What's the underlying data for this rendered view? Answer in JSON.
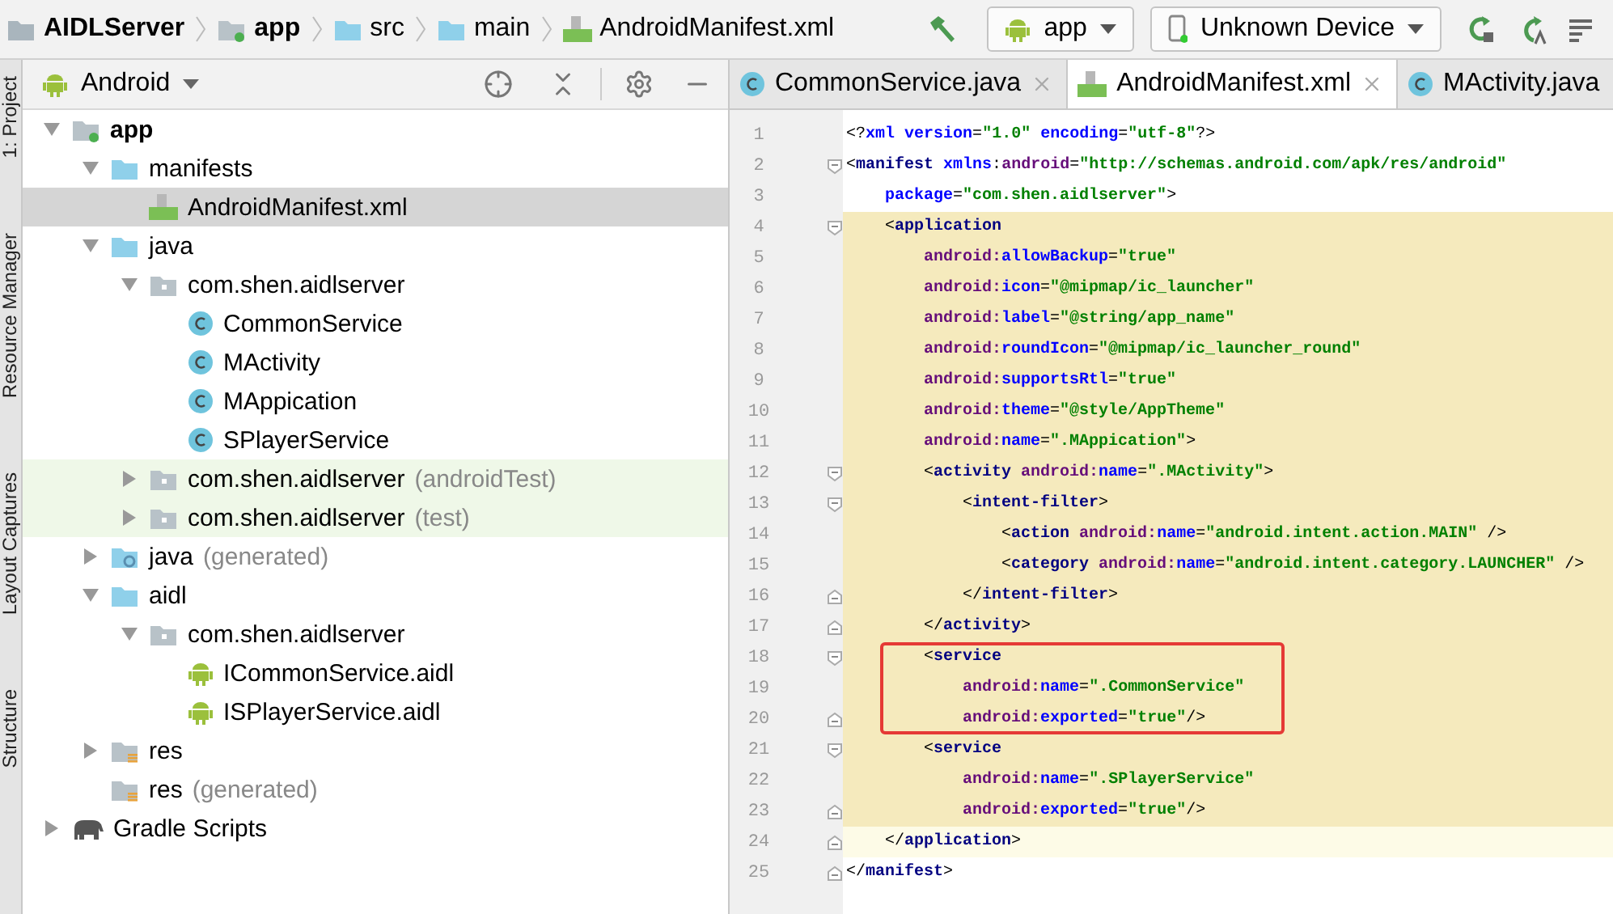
{
  "breadcrumbs": [
    {
      "label": "AIDLServer",
      "kind": "project",
      "bold": true
    },
    {
      "label": "app",
      "kind": "module",
      "bold": true
    },
    {
      "label": "src",
      "kind": "folder",
      "bold": false
    },
    {
      "label": "main",
      "kind": "folder",
      "bold": false
    },
    {
      "label": "AndroidManifest.xml",
      "kind": "manifest",
      "bold": false
    }
  ],
  "toolbar": {
    "run_config": "app",
    "device": "Unknown Device"
  },
  "side_tabs": [
    "1: Project",
    "Resource Manager",
    "Layout Captures",
    "Structure"
  ],
  "project_panel": {
    "view": "Android",
    "tree": [
      {
        "label": "app",
        "kind": "module",
        "bold": true,
        "selected": false,
        "expanded": true,
        "children": [
          {
            "label": "manifests",
            "kind": "folder",
            "selected": false,
            "expanded": true,
            "children": [
              {
                "label": "AndroidManifest.xml",
                "kind": "manifest",
                "selected": true
              }
            ]
          },
          {
            "label": "java",
            "kind": "folder",
            "selected": false,
            "expanded": true,
            "children": [
              {
                "label": "com.shen.aidlserver",
                "kind": "package",
                "selected": false,
                "expanded": true,
                "children": [
                  {
                    "label": "CommonService",
                    "kind": "class",
                    "selected": false
                  },
                  {
                    "label": "MActivity",
                    "kind": "class",
                    "selected": false
                  },
                  {
                    "label": "MAppication",
                    "kind": "class",
                    "selected": false
                  },
                  {
                    "label": "SPlayerService",
                    "kind": "class",
                    "selected": false
                  }
                ]
              },
              {
                "label": "com.shen.aidlserver",
                "suffix": "(androidTest)",
                "test": true,
                "kind": "package",
                "selected": false,
                "expanded": false
              },
              {
                "label": "com.shen.aidlserver",
                "suffix": "(test)",
                "test": true,
                "kind": "package",
                "selected": false,
                "expanded": false
              }
            ]
          },
          {
            "label": "java",
            "suffix": "(generated)",
            "kind": "generated",
            "selected": false,
            "expanded": false
          },
          {
            "label": "aidl",
            "kind": "folder",
            "selected": false,
            "expanded": true,
            "children": [
              {
                "label": "com.shen.aidlserver",
                "kind": "package",
                "selected": false,
                "expanded": true,
                "children": [
                  {
                    "label": "ICommonService.aidl",
                    "kind": "aidl",
                    "selected": false
                  },
                  {
                    "label": "ISPlayerService.aidl",
                    "kind": "aidl",
                    "selected": false
                  }
                ]
              }
            ]
          },
          {
            "label": "res",
            "kind": "res",
            "selected": false,
            "expanded": false
          },
          {
            "label": "res",
            "suffix": "(generated)",
            "kind": "res",
            "selected": false
          }
        ]
      },
      {
        "label": "Gradle Scripts",
        "kind": "gradle",
        "selected": false,
        "expanded": false
      }
    ]
  },
  "editor_tabs": [
    {
      "label": "CommonService.java",
      "kind": "class",
      "selected": false
    },
    {
      "label": "AndroidManifest.xml",
      "kind": "manifest",
      "selected": true
    },
    {
      "label": "MActivity.java",
      "kind": "class",
      "selected": false
    }
  ],
  "code_lines": [
    {
      "number": "1",
      "tokens": [
        {
          "kind": "p",
          "text": "<?"
        },
        {
          "kind": "attr",
          "text": "xml "
        },
        {
          "kind": "attr",
          "text": "version"
        },
        {
          "kind": "p",
          "text": "="
        },
        {
          "kind": "val",
          "text": "\"1.0\" "
        },
        {
          "kind": "attr",
          "text": "encoding"
        },
        {
          "kind": "p",
          "text": "="
        },
        {
          "kind": "val",
          "text": "\"utf-8\""
        },
        {
          "kind": "p",
          "text": "?>"
        }
      ]
    },
    {
      "number": "2",
      "fold_start": true,
      "tokens": [
        {
          "kind": "p",
          "text": "<"
        },
        {
          "kind": "tag",
          "text": "manifest "
        },
        {
          "kind": "attr",
          "text": "xmlns"
        },
        {
          "kind": "p",
          "text": ":"
        },
        {
          "kind": "ns",
          "text": "android"
        },
        {
          "kind": "p",
          "text": "="
        },
        {
          "kind": "val",
          "text": "\"http://schemas.android.com/apk/res/android\""
        }
      ]
    },
    {
      "number": "3",
      "tokens": [
        {
          "kind": "attr",
          "text": "    package"
        },
        {
          "kind": "p",
          "text": "="
        },
        {
          "kind": "val",
          "text": "\"com.shen.aidlserver\""
        },
        {
          "kind": "p",
          "text": ">"
        }
      ]
    },
    {
      "number": "4",
      "fold_start": true,
      "highlighted": true,
      "tokens": [
        {
          "kind": "p",
          "text": "    <"
        },
        {
          "kind": "tag",
          "text": "application"
        }
      ]
    },
    {
      "number": "5",
      "highlighted": true,
      "tokens": [
        {
          "kind": "ns",
          "text": "        android:"
        },
        {
          "kind": "attr",
          "text": "allowBackup"
        },
        {
          "kind": "p",
          "text": "="
        },
        {
          "kind": "val",
          "text": "\"true\""
        }
      ]
    },
    {
      "number": "6",
      "highlighted": true,
      "tokens": [
        {
          "kind": "ns",
          "text": "        android:"
        },
        {
          "kind": "attr",
          "text": "icon"
        },
        {
          "kind": "p",
          "text": "="
        },
        {
          "kind": "val",
          "text": "\"@mipmap/ic_launcher\""
        }
      ]
    },
    {
      "number": "7",
      "highlighted": true,
      "tokens": [
        {
          "kind": "ns",
          "text": "        android:"
        },
        {
          "kind": "attr",
          "text": "label"
        },
        {
          "kind": "p",
          "text": "="
        },
        {
          "kind": "val",
          "text": "\"@string/app_name\""
        }
      ]
    },
    {
      "number": "8",
      "highlighted": true,
      "tokens": [
        {
          "kind": "ns",
          "text": "        android:"
        },
        {
          "kind": "attr",
          "text": "roundIcon"
        },
        {
          "kind": "p",
          "text": "="
        },
        {
          "kind": "val",
          "text": "\"@mipmap/ic_launcher_round\""
        }
      ]
    },
    {
      "number": "9",
      "highlighted": true,
      "tokens": [
        {
          "kind": "ns",
          "text": "        android:"
        },
        {
          "kind": "attr",
          "text": "supportsRtl"
        },
        {
          "kind": "p",
          "text": "="
        },
        {
          "kind": "val",
          "text": "\"true\""
        }
      ]
    },
    {
      "number": "10",
      "highlighted": true,
      "tokens": [
        {
          "kind": "ns",
          "text": "        android:"
        },
        {
          "kind": "attr",
          "text": "theme"
        },
        {
          "kind": "p",
          "text": "="
        },
        {
          "kind": "val",
          "text": "\"@style/AppTheme\""
        }
      ]
    },
    {
      "number": "11",
      "highlighted": true,
      "tokens": [
        {
          "kind": "ns",
          "text": "        android:"
        },
        {
          "kind": "attr",
          "text": "name"
        },
        {
          "kind": "p",
          "text": "="
        },
        {
          "kind": "val",
          "text": "\".MAppication\""
        },
        {
          "kind": "p",
          "text": ">"
        }
      ]
    },
    {
      "number": "12",
      "fold_start": true,
      "highlighted": true,
      "tokens": [
        {
          "kind": "p",
          "text": "        <"
        },
        {
          "kind": "tag",
          "text": "activity "
        },
        {
          "kind": "ns",
          "text": "android:"
        },
        {
          "kind": "attr",
          "text": "name"
        },
        {
          "kind": "p",
          "text": "="
        },
        {
          "kind": "val",
          "text": "\".MActivity\""
        },
        {
          "kind": "p",
          "text": ">"
        }
      ]
    },
    {
      "number": "13",
      "fold_start": true,
      "highlighted": true,
      "tokens": [
        {
          "kind": "p",
          "text": "            <"
        },
        {
          "kind": "tag",
          "text": "intent-filter"
        },
        {
          "kind": "p",
          "text": ">"
        }
      ]
    },
    {
      "number": "14",
      "highlighted": true,
      "tokens": [
        {
          "kind": "p",
          "text": "                <"
        },
        {
          "kind": "tag",
          "text": "action "
        },
        {
          "kind": "ns",
          "text": "android:"
        },
        {
          "kind": "attr",
          "text": "name"
        },
        {
          "kind": "p",
          "text": "="
        },
        {
          "kind": "val",
          "text": "\"android.intent.action.MAIN\""
        },
        {
          "kind": "p",
          "text": " />"
        }
      ]
    },
    {
      "number": "15",
      "highlighted": true,
      "tokens": [
        {
          "kind": "p",
          "text": "                <"
        },
        {
          "kind": "tag",
          "text": "category "
        },
        {
          "kind": "ns",
          "text": "android:"
        },
        {
          "kind": "attr",
          "text": "name"
        },
        {
          "kind": "p",
          "text": "="
        },
        {
          "kind": "val",
          "text": "\"android.intent.category.LAUNCHER\""
        },
        {
          "kind": "p",
          "text": " />"
        }
      ]
    },
    {
      "number": "16",
      "fold_end": true,
      "highlighted": true,
      "tokens": [
        {
          "kind": "p",
          "text": "            </"
        },
        {
          "kind": "tag",
          "text": "intent-filter"
        },
        {
          "kind": "p",
          "text": ">"
        }
      ]
    },
    {
      "number": "17",
      "fold_end": true,
      "highlighted": true,
      "tokens": [
        {
          "kind": "p",
          "text": "        </"
        },
        {
          "kind": "tag",
          "text": "activity"
        },
        {
          "kind": "p",
          "text": ">"
        }
      ]
    },
    {
      "number": "18",
      "fold_start": true,
      "highlighted": true,
      "boxed": true,
      "tokens": [
        {
          "kind": "p",
          "text": "        <"
        },
        {
          "kind": "tag",
          "text": "service"
        }
      ]
    },
    {
      "number": "19",
      "highlighted": true,
      "boxed": true,
      "tokens": [
        {
          "kind": "ns",
          "text": "            android:"
        },
        {
          "kind": "attr",
          "text": "name"
        },
        {
          "kind": "p",
          "text": "="
        },
        {
          "kind": "val",
          "text": "\".CommonService\""
        }
      ]
    },
    {
      "number": "20",
      "fold_end": true,
      "highlighted": true,
      "boxed": true,
      "tokens": [
        {
          "kind": "ns",
          "text": "            android:"
        },
        {
          "kind": "attr",
          "text": "exported"
        },
        {
          "kind": "p",
          "text": "="
        },
        {
          "kind": "val",
          "text": "\"true\""
        },
        {
          "kind": "p",
          "text": "/>"
        }
      ]
    },
    {
      "number": "21",
      "fold_start": true,
      "highlighted": true,
      "tokens": [
        {
          "kind": "p",
          "text": "        <"
        },
        {
          "kind": "tag",
          "text": "service"
        }
      ]
    },
    {
      "number": "22",
      "highlighted": true,
      "tokens": [
        {
          "kind": "ns",
          "text": "            android:"
        },
        {
          "kind": "attr",
          "text": "name"
        },
        {
          "kind": "p",
          "text": "="
        },
        {
          "kind": "val",
          "text": "\".SPlayerService\""
        }
      ]
    },
    {
      "number": "23",
      "fold_end": true,
      "highlighted": true,
      "tokens": [
        {
          "kind": "ns",
          "text": "            android:"
        },
        {
          "kind": "attr",
          "text": "exported"
        },
        {
          "kind": "p",
          "text": "="
        },
        {
          "kind": "val",
          "text": "\"true\""
        },
        {
          "kind": "p",
          "text": "/>"
        }
      ]
    },
    {
      "number": "24",
      "fold_end": true,
      "current": true,
      "tokens": [
        {
          "kind": "p",
          "text": "    </"
        },
        {
          "kind": "tag",
          "text": "application"
        },
        {
          "kind": "p",
          "text": ">"
        }
      ]
    },
    {
      "number": "25",
      "fold_end": true,
      "tokens": [
        {
          "kind": "p",
          "text": "</"
        },
        {
          "kind": "tag",
          "text": "manifest"
        },
        {
          "kind": "p",
          "text": ">"
        }
      ]
    }
  ]
}
